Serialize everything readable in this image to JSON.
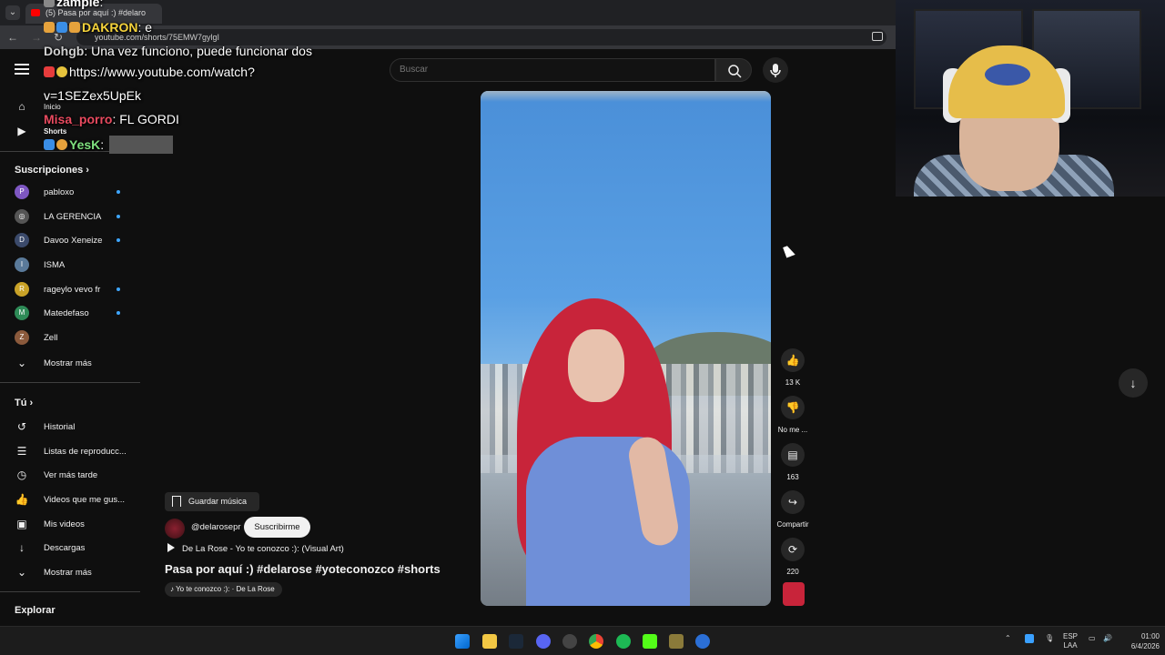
{
  "browser": {
    "tab_title": "(5) Pasa por aquí :) #delaro",
    "url": "youtube.com/shorts/75EMW7gylgI"
  },
  "chat": [
    {
      "user": "zample",
      "text": ""
    },
    {
      "user": "DAKRON",
      "text": "e"
    },
    {
      "user": "Dohgb",
      "text": "Una vez funciono, puede funcionar dos"
    },
    {
      "user": "",
      "text": "https://www.youtube.com/watch?"
    },
    {
      "user": "",
      "text": "v=1SEZex5UpEk"
    },
    {
      "user": "Misa_porro",
      "text": "FL GORDI"
    },
    {
      "user": "YesK",
      "text": ""
    }
  ],
  "sidebar": {
    "home": "Inicio",
    "shorts": "Shorts",
    "subs_header": "Suscripciones",
    "subs": [
      {
        "name": "pabloxo",
        "initial": "P",
        "color": "#7e57c2",
        "new": true
      },
      {
        "name": "LA GERENCIA",
        "initial": "◎",
        "color": "#555555",
        "new": true
      },
      {
        "name": "Davoo Xeneize",
        "initial": "D",
        "color": "#3b4a6b",
        "new": true
      },
      {
        "name": "ISMA",
        "initial": "I",
        "color": "#5a7a9a",
        "new": false
      },
      {
        "name": "rageylo vevo fr",
        "initial": "R",
        "color": "#c9a227",
        "new": true
      },
      {
        "name": "Matedefaso",
        "initial": "M",
        "color": "#2e8b57",
        "new": true
      },
      {
        "name": "Zell",
        "initial": "Z",
        "color": "#8b5a3c",
        "new": false
      }
    ],
    "show_more": "Mostrar más",
    "you_header": "Tú",
    "you_items": [
      "Historial",
      "Listas de reproducc...",
      "Ver más tarde",
      "Videos que me gus...",
      "Mis videos",
      "Descargas",
      "Mostrar más"
    ],
    "explore": "Explorar"
  },
  "search": {
    "placeholder": "Buscar"
  },
  "actions": {
    "likes": "13 K",
    "dislike": "No me ...",
    "comments": "163",
    "share": "Compartir",
    "remix": "220"
  },
  "info": {
    "save_music": "Guardar música",
    "channel": "@delarosepr",
    "subscribe": "Suscribirme",
    "song": "De La Rose - Yo te conozco :): (Visual Art)",
    "title": "Pasa por aquí :) #delarose #yoteconozco #shorts",
    "audio": "Yo te conozco :): · De La Rose"
  },
  "taskbar": {
    "lang": "ESP",
    "lang2": "LAA",
    "time": "01:00",
    "date": "6/4/2026"
  }
}
